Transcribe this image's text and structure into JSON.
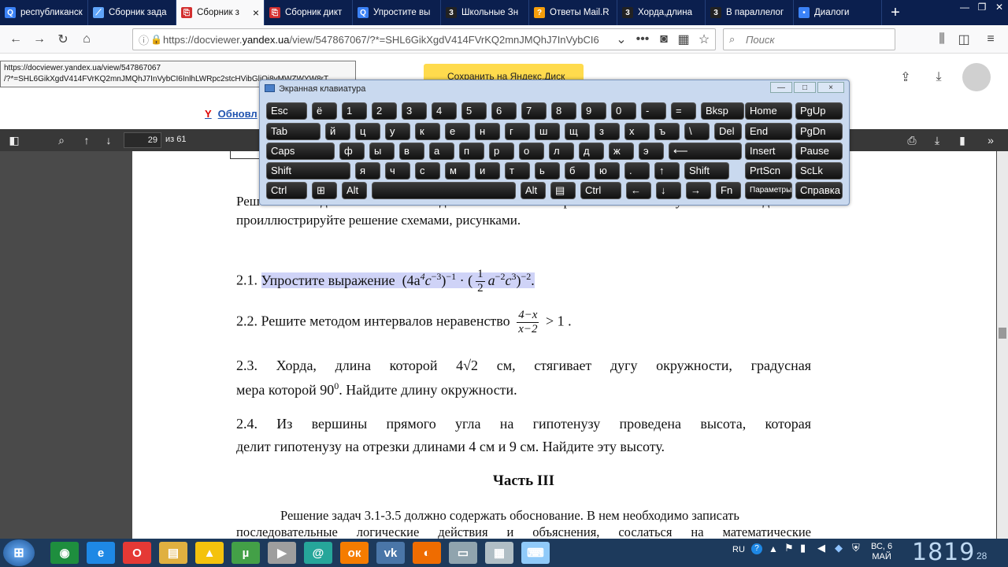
{
  "browser": {
    "tabs": [
      {
        "label": "республиканск",
        "icon": "search-icon",
        "color": "#3b82f6"
      },
      {
        "label": "Сборник зада",
        "icon": "comet-icon",
        "color": "#60a5fa"
      },
      {
        "label": "Сборник з",
        "icon": "pdf-icon",
        "color": "#d32f2f",
        "active": true
      },
      {
        "label": "Сборник дикт",
        "icon": "pdf-icon",
        "color": "#d32f2f"
      },
      {
        "label": "Упростите вы",
        "icon": "search-icon",
        "color": "#3b82f6"
      },
      {
        "label": "Школьные Зн",
        "icon": "znanija-icon",
        "color": "#222"
      },
      {
        "label": "Ответы Mail.R",
        "icon": "question-icon",
        "color": "#f59e0b"
      },
      {
        "label": "Хорда,длина",
        "icon": "znanija-icon",
        "color": "#222"
      },
      {
        "label": "В параллелог",
        "icon": "znanija-icon",
        "color": "#222"
      },
      {
        "label": "Диалоги",
        "icon": "dot-icon",
        "color": "#3b82f6"
      }
    ],
    "close_symbol": "×",
    "new_tab_symbol": "+",
    "url_prefix": "https://docviewer.",
    "url_host": "yandex.ua",
    "url_rest": "/view/547867067/?*=SHL6GikXgdV414FVrKQ2mnJMQhJ7InVybCI6",
    "search_placeholder": "Поиск",
    "tooltip_line1": "https://docviewer.yandex.ua/view/547867067",
    "tooltip_line2": "/?*=SHL6GikXgdV414FVrKQ2mnJMQhJ7InVybCI6InlhLWRpc2stcHVibGljOi8vMWZWYW8rT"
  },
  "yandex": {
    "save_button": "Сохранить на Яндекс.Диск",
    "update_link": "Обновл",
    "y_logo": "Y"
  },
  "viewer": {
    "page_number": "29",
    "page_count": "из 61"
  },
  "keyboard": {
    "title": "Экранная клавиатура",
    "min": "—",
    "max": "□",
    "close": "×"
  },
  "document": {
    "intro_line1": "Решение заданий 2.1-2.4 должно быть кратким. В случае необходимости",
    "intro_line2": "проиллюстрируйте решение схемами, рисунками.",
    "task_2_1_num": "2.1.",
    "task_2_1_text": "Упростите выражение",
    "task_2_1_expr": "(4a⁴c⁻³)⁻¹ · (½ a⁻²c³)⁻²",
    "task_2_1_expr_left": "(4a",
    "task_2_1_exp4": "4",
    "task_2_1_c": "c",
    "task_2_1_expm3": "−3",
    "task_2_1_close": ")",
    "task_2_1_expm1": "−1",
    "task_2_1_dot": "·",
    "task_2_1_open2": "(",
    "task_2_1_frac_num": "1",
    "task_2_1_frac_den": "2",
    "task_2_1_a2": "a",
    "task_2_1_expm2": "−2",
    "task_2_1_c2": "c",
    "task_2_1_exp3": "3",
    "task_2_1_close2": ")",
    "task_2_1_expm2b": "−2",
    "task_2_1_period": ".",
    "task_2_2_num": "2.2.",
    "task_2_2_text": "Решите методом интервалов неравенство",
    "task_2_2_num_frac": "4−x",
    "task_2_2_den_frac": "x−2",
    "task_2_2_rhs": "> 1 .",
    "task_2_3_line1_a": "2.3. Хорда, длина которой 4",
    "task_2_3_sqrt": "√2",
    "task_2_3_line1_b": "см, стягивает дугу окружности, градусная",
    "task_2_3_line2_a": "мера которой 90",
    "task_2_3_deg": "0",
    "task_2_3_line2_b": ". Найдите длину окружности.",
    "task_2_4_line1": "2.4. Из вершины прямого угла на гипотенузу проведена высота, которая",
    "task_2_4_line2": "делит гипотенузу на отрезки длинами 4 см и 9 см. Найдите эту высоту.",
    "part3_title": "Часть III",
    "part3_line1": "Решение задач 3.1-3.5 должно содержать обоснование. В нем необходимо записать",
    "part3_line2": "последовательные логические действия и объяснения, сослаться на математические"
  },
  "taskbar": {
    "apps": [
      {
        "name": "chrome-icon",
        "glyph": "◉",
        "color": "#1e8e3e"
      },
      {
        "name": "ie-icon",
        "glyph": "e",
        "color": "#1e88e5"
      },
      {
        "name": "opera-icon",
        "glyph": "O",
        "color": "#e53935"
      },
      {
        "name": "folder-icon",
        "glyph": "▤",
        "color": "#e0b040"
      },
      {
        "name": "daemon-icon",
        "glyph": "▲",
        "color": "#f4c20d"
      },
      {
        "name": "utorrent-icon",
        "glyph": "µ",
        "color": "#43a047"
      },
      {
        "name": "media-icon",
        "glyph": "▶",
        "color": "#9e9e9e"
      },
      {
        "name": "mail-agent-icon",
        "glyph": "@",
        "color": "#26a69a"
      },
      {
        "name": "odnoklassniki-icon",
        "glyph": "ок",
        "color": "#f57c00"
      },
      {
        "name": "vk-icon",
        "glyph": "vk",
        "color": "#4a76a8"
      },
      {
        "name": "firefox-icon",
        "glyph": "◐",
        "color": "#ef6c00"
      },
      {
        "name": "explorer-window-icon",
        "glyph": "▭",
        "color": "#90a4ae"
      },
      {
        "name": "calculator-icon",
        "glyph": "▦",
        "color": "#b0bec5"
      },
      {
        "name": "keyboard-icon",
        "glyph": "⌨",
        "color": "#90caf9"
      }
    ],
    "lang": "RU",
    "day": "ВС, 6",
    "month": "МАЙ",
    "time": "1819",
    "seconds": "28"
  }
}
